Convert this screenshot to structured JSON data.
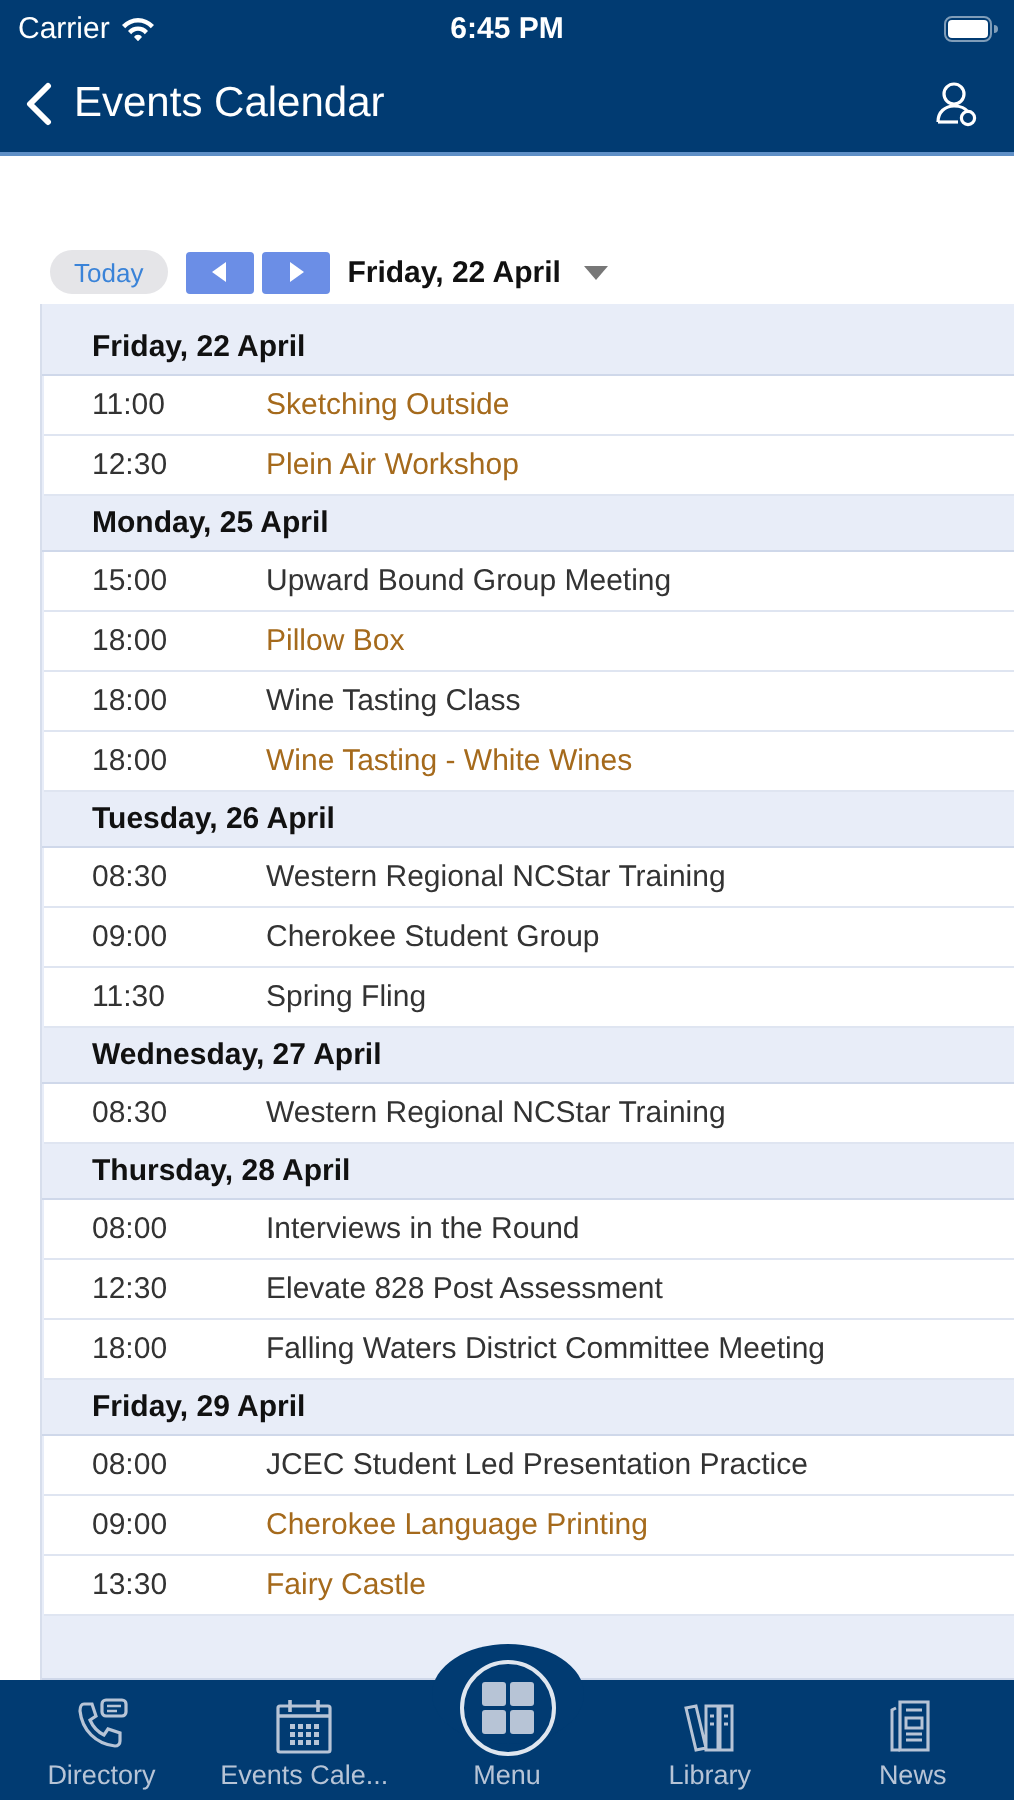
{
  "status_bar": {
    "carrier": "Carrier",
    "time": "6:45 PM"
  },
  "nav": {
    "title": "Events Calendar"
  },
  "toolbar": {
    "today": "Today",
    "date": "Friday, 22 April"
  },
  "days": [
    {
      "heading": "Friday, 22 April",
      "events": [
        {
          "time": "11:00",
          "title": "Sketching Outside",
          "linked": true
        },
        {
          "time": "12:30",
          "title": "Plein Air Workshop",
          "linked": true
        }
      ]
    },
    {
      "heading": "Monday, 25 April",
      "events": [
        {
          "time": "15:00",
          "title": "Upward Bound Group Meeting",
          "linked": false
        },
        {
          "time": "18:00",
          "title": "Pillow Box",
          "linked": true
        },
        {
          "time": "18:00",
          "title": "Wine Tasting Class",
          "linked": false
        },
        {
          "time": "18:00",
          "title": "Wine Tasting - White Wines",
          "linked": true
        }
      ]
    },
    {
      "heading": "Tuesday, 26 April",
      "events": [
        {
          "time": "08:30",
          "title": "Western Regional NCStar Training",
          "linked": false
        },
        {
          "time": "09:00",
          "title": "Cherokee Student Group",
          "linked": false
        },
        {
          "time": "11:30",
          "title": "Spring Fling",
          "linked": false
        }
      ]
    },
    {
      "heading": "Wednesday, 27 April",
      "events": [
        {
          "time": "08:30",
          "title": "Western Regional NCStar Training",
          "linked": false
        }
      ]
    },
    {
      "heading": "Thursday, 28 April",
      "events": [
        {
          "time": "08:00",
          "title": "Interviews in the Round",
          "linked": false
        },
        {
          "time": "12:30",
          "title": "Elevate 828 Post Assessment",
          "linked": false
        },
        {
          "time": "18:00",
          "title": "Falling Waters District Committee Meeting",
          "linked": false
        }
      ]
    },
    {
      "heading": "Friday, 29 April",
      "events": [
        {
          "time": "08:00",
          "title": "JCEC Student Led Presentation Practice",
          "linked": false
        },
        {
          "time": "09:00",
          "title": "Cherokee Language Printing",
          "linked": true
        },
        {
          "time": "13:30",
          "title": "Fairy Castle",
          "linked": true
        }
      ]
    }
  ],
  "tab_bar": [
    {
      "label": "Directory",
      "kind": "phone"
    },
    {
      "label": "Events Cale...",
      "kind": "calendar"
    },
    {
      "label": "Menu",
      "kind": "menu"
    },
    {
      "label": "Library",
      "kind": "books"
    },
    {
      "label": "News",
      "kind": "news"
    }
  ]
}
